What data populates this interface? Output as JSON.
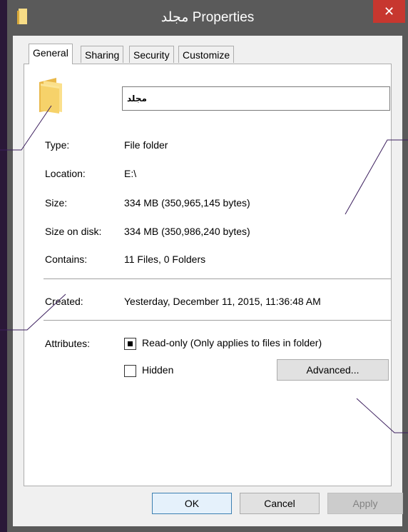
{
  "window": {
    "title": "مجلد Properties",
    "close_glyph": "✕"
  },
  "tabs": [
    {
      "label": "General"
    },
    {
      "label": "Sharing"
    },
    {
      "label": "Security"
    },
    {
      "label": "Customize"
    }
  ],
  "folder_name": "مجلد",
  "fields": {
    "type": {
      "label": "Type:",
      "value": "File folder"
    },
    "location": {
      "label": "Location:",
      "value": "E:\\"
    },
    "size": {
      "label": "Size:",
      "value": "334 MB (350,965,145 bytes)"
    },
    "size_on_disk": {
      "label": "Size on disk:",
      "value": "334 MB (350,986,240 bytes)"
    },
    "contains": {
      "label": "Contains:",
      "value": "11 Files, 0 Folders"
    },
    "created": {
      "label": "Created:",
      "value": "Yesterday, December 11, 2015, 11:36:48 AM"
    }
  },
  "attributes": {
    "label": "Attributes:",
    "readonly": {
      "label": "Read-only (Only applies to files in folder)",
      "state": "indeterminate"
    },
    "hidden": {
      "label": "Hidden",
      "state": "unchecked"
    },
    "advanced_button": "Advanced..."
  },
  "buttons": {
    "ok": "OK",
    "cancel": "Cancel",
    "apply": "Apply"
  },
  "colors": {
    "folder": "#f7d46b",
    "accent": "#c7372f",
    "annotation_line": "#3c1f5e"
  }
}
